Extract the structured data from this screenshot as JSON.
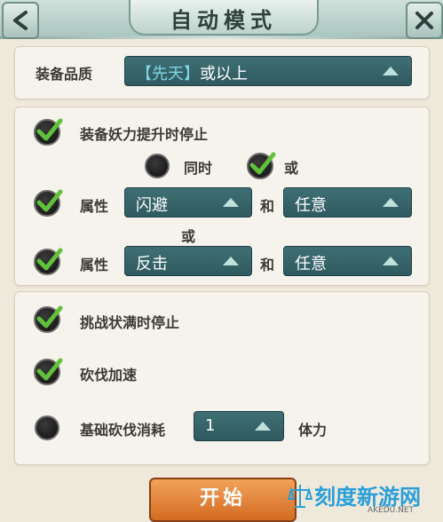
{
  "header": {
    "title": "自动模式",
    "back_icon": "back-arrow-icon",
    "close_icon": "close-x-icon"
  },
  "quality": {
    "label": "装备品质",
    "bracket_open": "【",
    "value": "先天",
    "bracket_close": "】",
    "suffix": "或以上"
  },
  "stop_on_power": {
    "label": "装备妖力提升时停止",
    "checked": true
  },
  "logic": {
    "and_label": "同时",
    "and_selected": false,
    "or_label": "或",
    "or_selected": true
  },
  "attr_row1": {
    "checked": true,
    "label": "属性",
    "value1": "闪避",
    "connector": "和",
    "value2": "任意"
  },
  "between_or": "或",
  "attr_row2": {
    "checked": true,
    "label": "属性",
    "value1": "反击",
    "connector": "和",
    "value2": "任意"
  },
  "stop_on_full": {
    "label": "挑战状满时停止",
    "checked": true
  },
  "chop_speed": {
    "label": "砍伐加速",
    "checked": true
  },
  "chop_cost": {
    "label": "基础砍伐消耗",
    "checked": false,
    "value": "1",
    "unit": "体力"
  },
  "start_button": "开始",
  "watermark": {
    "cn": "刻度新游网",
    "en": "AKEDU.NET"
  },
  "colors": {
    "dropdown_bg": "#2e5a60",
    "start_button": "#d46b22",
    "check_green": "#5fc23a",
    "panel_bg": "#f6f3ec"
  }
}
